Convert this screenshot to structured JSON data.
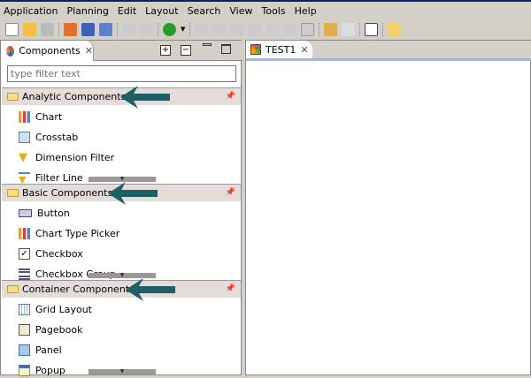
{
  "menu": [
    "Application",
    "Planning",
    "Edit",
    "Layout",
    "Search",
    "View",
    "Tools",
    "Help"
  ],
  "panel": {
    "title": "Components",
    "filter_placeholder": "type filter text"
  },
  "editor": {
    "tab": "TEST1"
  },
  "sections": [
    {
      "title": "Analytic Components",
      "items": [
        "Chart",
        "Crosstab",
        "Dimension Filter",
        "Filter Line"
      ]
    },
    {
      "title": "Basic Components",
      "items": [
        "Button",
        "Chart Type Picker",
        "Checkbox",
        "Checkbox Group"
      ]
    },
    {
      "title": "Container Components",
      "items": [
        "Grid Layout",
        "Pagebook",
        "Panel",
        "Popup"
      ]
    }
  ],
  "colors": {
    "arrow": "#1d5f66",
    "section_bg": "#e3dcd8"
  }
}
